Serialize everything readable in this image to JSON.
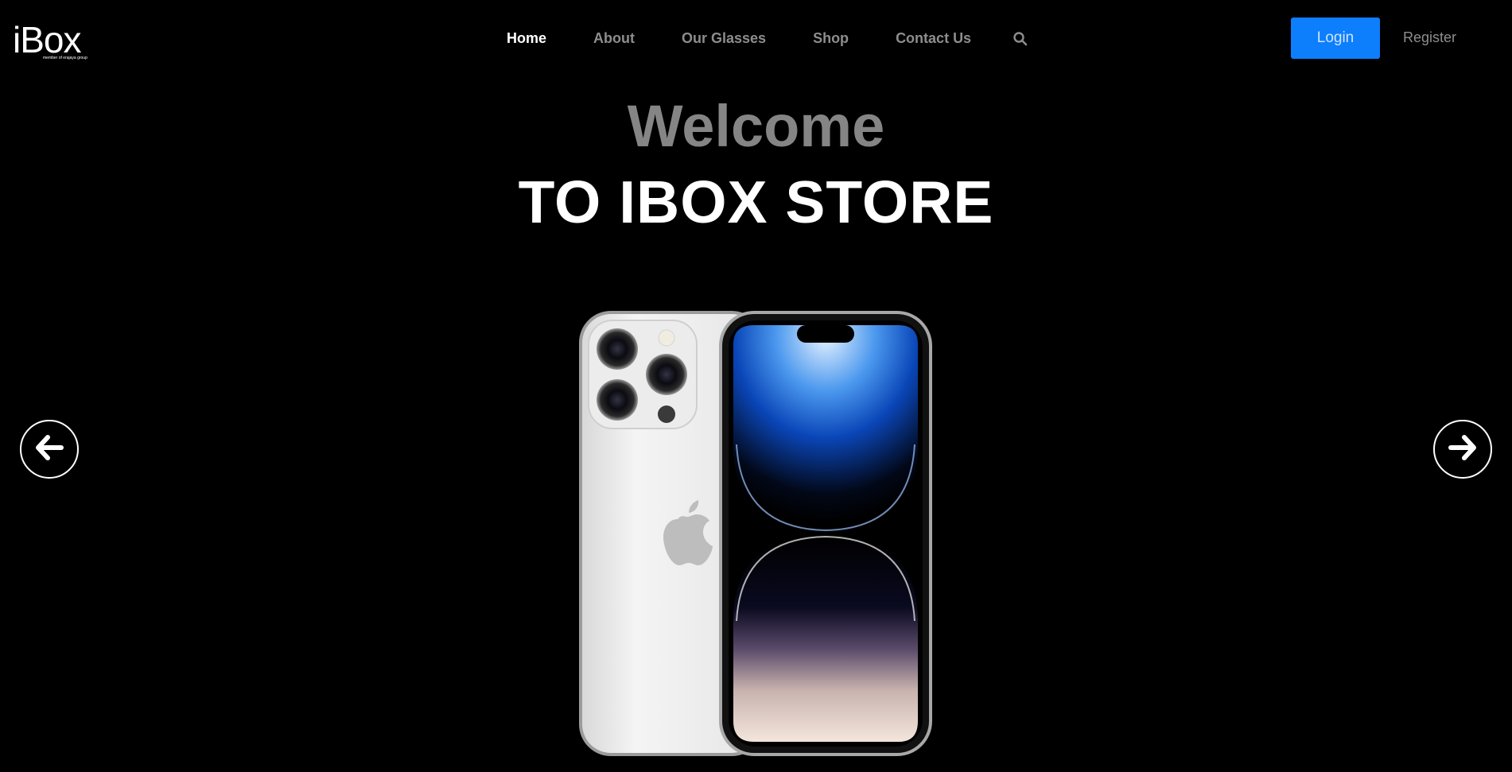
{
  "brand": {
    "name": "iBox",
    "tagline": "member of erajaya group"
  },
  "nav": {
    "items": [
      {
        "label": "Home",
        "active": true
      },
      {
        "label": "About",
        "active": false
      },
      {
        "label": "Our Glasses",
        "active": false
      },
      {
        "label": "Shop",
        "active": false
      },
      {
        "label": "Contact Us",
        "active": false
      }
    ],
    "search_icon": "search-icon"
  },
  "auth": {
    "login_label": "Login",
    "register_label": "Register"
  },
  "hero": {
    "welcome": "Welcome",
    "title": "TO IBOX STORE",
    "prev_icon": "arrow-left-icon",
    "next_icon": "arrow-right-icon"
  },
  "colors": {
    "background": "#000000",
    "accent": "#0d7efc",
    "nav_inactive": "#8d8d8d",
    "welcome_text": "#858585"
  }
}
